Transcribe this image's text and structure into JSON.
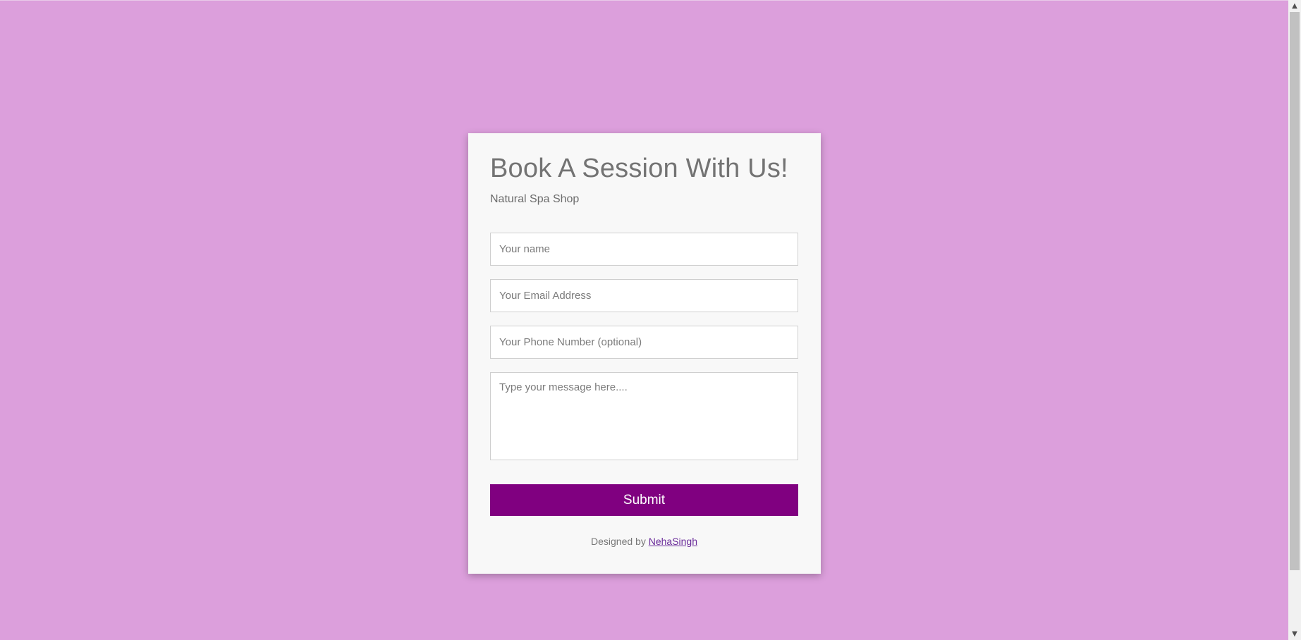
{
  "page": {
    "background_color": "#dc9fdc",
    "card_color": "#f8f8f8",
    "accent_color": "#800080"
  },
  "form": {
    "title": "Book A Session With Us!",
    "subtitle": "Natural Spa Shop",
    "name_placeholder": "Your name",
    "email_placeholder": "Your Email Address",
    "phone_placeholder": "Your Phone Number (optional)",
    "message_placeholder": "Type your message here....",
    "submit_label": "Submit"
  },
  "footer": {
    "prefix": "Designed by",
    "author_link": "NehaSingh"
  },
  "scrollbar": {
    "up_icon": "chevron-up-icon",
    "down_icon": "chevron-down-icon"
  }
}
